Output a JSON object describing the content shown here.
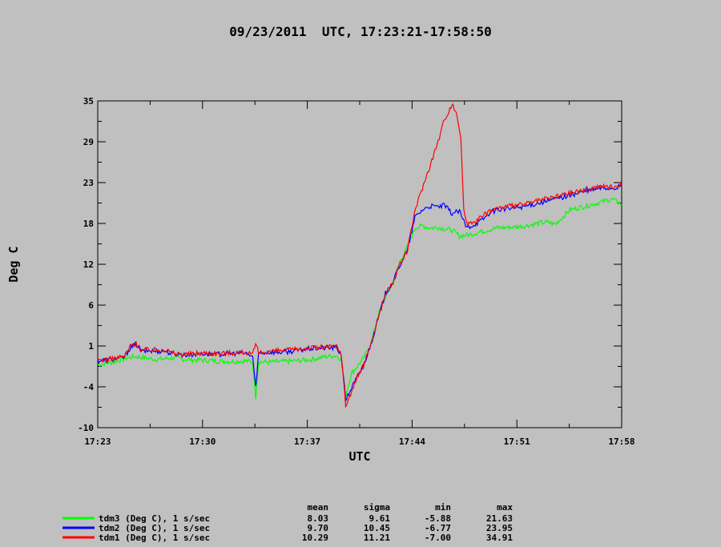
{
  "chart_data": {
    "type": "line",
    "title": "09/23/2011  UTC, 17:23:21-17:58:50",
    "xlabel": "UTC",
    "ylabel": "Deg C",
    "xticks": [
      "17:23",
      "17:30",
      "17:37",
      "17:44",
      "17:51",
      "17:58"
    ],
    "yticks": [
      "35",
      "29",
      "23",
      "18",
      "12",
      "6",
      "1",
      "-4",
      "-10"
    ],
    "xlim_minutes": [
      0,
      35.5
    ],
    "ylim": [
      -10,
      35
    ],
    "grid": false,
    "legend_placement": "bottom-left",
    "stats_headers": [
      "mean",
      "sigma",
      "min",
      "max"
    ],
    "series": [
      {
        "name": "tdm3 (Deg C), 1 s/sec",
        "color": "#00ff00",
        "stats": [
          "8.03",
          "9.61",
          "-5.88",
          "21.63"
        ],
        "points": [
          [
            0,
            -1.3
          ],
          [
            1,
            -1
          ],
          [
            1.8,
            -0.5
          ],
          [
            2.5,
            -0.2
          ],
          [
            3,
            -0.3
          ],
          [
            3.5,
            -0.5
          ],
          [
            4.2,
            -0.6
          ],
          [
            5,
            -0.4
          ],
          [
            6,
            -0.6
          ],
          [
            7,
            -0.7
          ],
          [
            8,
            -0.8
          ],
          [
            9,
            -0.9
          ],
          [
            10,
            -0.8
          ],
          [
            10.5,
            -1.0
          ],
          [
            10.7,
            -5.8
          ],
          [
            10.9,
            -0.9
          ],
          [
            11.5,
            -1.0
          ],
          [
            12.5,
            -0.9
          ],
          [
            13.5,
            -0.8
          ],
          [
            14.5,
            -0.6
          ],
          [
            15.5,
            -0.2
          ],
          [
            16.2,
            -0.1
          ],
          [
            16.5,
            -0.6
          ],
          [
            16.8,
            -5.5
          ],
          [
            17.2,
            -2.5
          ],
          [
            17.6,
            -1.5
          ],
          [
            18,
            -0.5
          ],
          [
            18.5,
            1.5
          ],
          [
            19,
            5.5
          ],
          [
            19.5,
            8
          ],
          [
            20,
            10
          ],
          [
            20.5,
            13
          ],
          [
            21,
            15
          ],
          [
            21.5,
            17.5
          ],
          [
            22,
            17.8
          ],
          [
            22.5,
            17.5
          ],
          [
            23,
            17.6
          ],
          [
            24,
            17.2
          ],
          [
            24.5,
            16.4
          ],
          [
            25,
            16.5
          ],
          [
            26,
            17
          ],
          [
            27,
            17.5
          ],
          [
            28,
            17.6
          ],
          [
            29,
            17.8
          ],
          [
            30,
            18.2
          ],
          [
            30.5,
            18.3
          ],
          [
            31,
            18
          ],
          [
            31.5,
            19
          ],
          [
            32,
            20
          ],
          [
            33,
            20.5
          ],
          [
            34,
            21
          ],
          [
            34.8,
            21.5
          ],
          [
            35.5,
            20.8
          ]
        ]
      },
      {
        "name": "tdm2 (Deg C), 1 s/sec",
        "color": "#0000ff",
        "stats": [
          "9.70",
          "10.45",
          "-6.77",
          "23.95"
        ],
        "points": [
          [
            0,
            -0.8
          ],
          [
            1,
            -0.6
          ],
          [
            1.8,
            -0.3
          ],
          [
            2.2,
            1.0
          ],
          [
            2.6,
            1.5
          ],
          [
            3,
            0.5
          ],
          [
            3.5,
            0.6
          ],
          [
            4,
            0.5
          ],
          [
            4.5,
            0.6
          ],
          [
            5,
            0.2
          ],
          [
            6,
            0.0
          ],
          [
            7,
            0.2
          ],
          [
            8,
            0.1
          ],
          [
            9,
            0.2
          ],
          [
            10,
            0.3
          ],
          [
            10.5,
            -0.2
          ],
          [
            10.7,
            -4.5
          ],
          [
            10.9,
            0.2
          ],
          [
            11.5,
            0.4
          ],
          [
            12.5,
            0.4
          ],
          [
            13.5,
            0.6
          ],
          [
            14.5,
            0.9
          ],
          [
            15.5,
            1.0
          ],
          [
            16.2,
            1.0
          ],
          [
            16.5,
            0.0
          ],
          [
            16.8,
            -6.2
          ],
          [
            17.2,
            -4.5
          ],
          [
            17.6,
            -3
          ],
          [
            18,
            -1.5
          ],
          [
            18.5,
            1.5
          ],
          [
            19,
            5
          ],
          [
            19.5,
            8.5
          ],
          [
            20,
            10
          ],
          [
            20.5,
            12.5
          ],
          [
            21,
            14.5
          ],
          [
            21.5,
            19
          ],
          [
            22,
            20
          ],
          [
            22.5,
            20.5
          ],
          [
            23,
            20.4
          ],
          [
            23.5,
            20.6
          ],
          [
            24,
            19.5
          ],
          [
            24.5,
            19.8
          ],
          [
            25,
            17.5
          ],
          [
            25.5,
            18
          ],
          [
            26,
            18.5
          ],
          [
            26.5,
            19.5
          ],
          [
            27,
            20
          ],
          [
            28,
            20.2
          ],
          [
            29,
            20.5
          ],
          [
            30,
            21
          ],
          [
            31,
            21.5
          ],
          [
            32,
            22
          ],
          [
            33,
            22.5
          ],
          [
            34,
            23
          ],
          [
            35,
            23
          ],
          [
            35.5,
            23.2
          ]
        ]
      },
      {
        "name": "tdm1 (Deg C), 1 s/sec",
        "color": "#ff0000",
        "stats": [
          "10.29",
          "11.21",
          "-7.00",
          "34.91"
        ],
        "points": [
          [
            0,
            -0.7
          ],
          [
            1,
            -0.5
          ],
          [
            1.8,
            -0.2
          ],
          [
            2.2,
            1.2
          ],
          [
            2.6,
            1.6
          ],
          [
            3,
            0.6
          ],
          [
            3.5,
            0.8
          ],
          [
            4,
            0.7
          ],
          [
            4.5,
            0.8
          ],
          [
            5,
            0.3
          ],
          [
            6,
            0.1
          ],
          [
            7,
            0.3
          ],
          [
            8,
            0.2
          ],
          [
            9,
            0.3
          ],
          [
            10,
            0.4
          ],
          [
            10.5,
            0.0
          ],
          [
            10.7,
            1.5
          ],
          [
            10.9,
            0.3
          ],
          [
            11.5,
            0.5
          ],
          [
            12.5,
            0.6
          ],
          [
            13.5,
            0.8
          ],
          [
            14.5,
            1.0
          ],
          [
            15.5,
            1.1
          ],
          [
            16.2,
            1.2
          ],
          [
            16.5,
            0.2
          ],
          [
            16.8,
            -7.0
          ],
          [
            17.2,
            -5
          ],
          [
            17.6,
            -3
          ],
          [
            18,
            -1.5
          ],
          [
            18.5,
            1.5
          ],
          [
            19,
            5
          ],
          [
            19.5,
            8.5
          ],
          [
            20,
            10
          ],
          [
            20.5,
            12.5
          ],
          [
            21,
            14.5
          ],
          [
            21.5,
            20
          ],
          [
            22,
            23
          ],
          [
            22.5,
            26
          ],
          [
            23,
            29
          ],
          [
            23.5,
            32.5
          ],
          [
            24,
            34.5
          ],
          [
            24.3,
            33.5
          ],
          [
            24.6,
            30
          ],
          [
            24.8,
            20.2
          ],
          [
            25,
            18
          ],
          [
            25.5,
            18.5
          ],
          [
            26,
            19
          ],
          [
            26.5,
            19.8
          ],
          [
            27,
            20.2
          ],
          [
            28,
            20.5
          ],
          [
            29,
            20.8
          ],
          [
            30,
            21.3
          ],
          [
            31,
            21.8
          ],
          [
            32,
            22.3
          ],
          [
            33,
            22.8
          ],
          [
            34,
            23.2
          ],
          [
            35,
            23.2
          ],
          [
            35.5,
            23.5
          ]
        ]
      }
    ]
  }
}
